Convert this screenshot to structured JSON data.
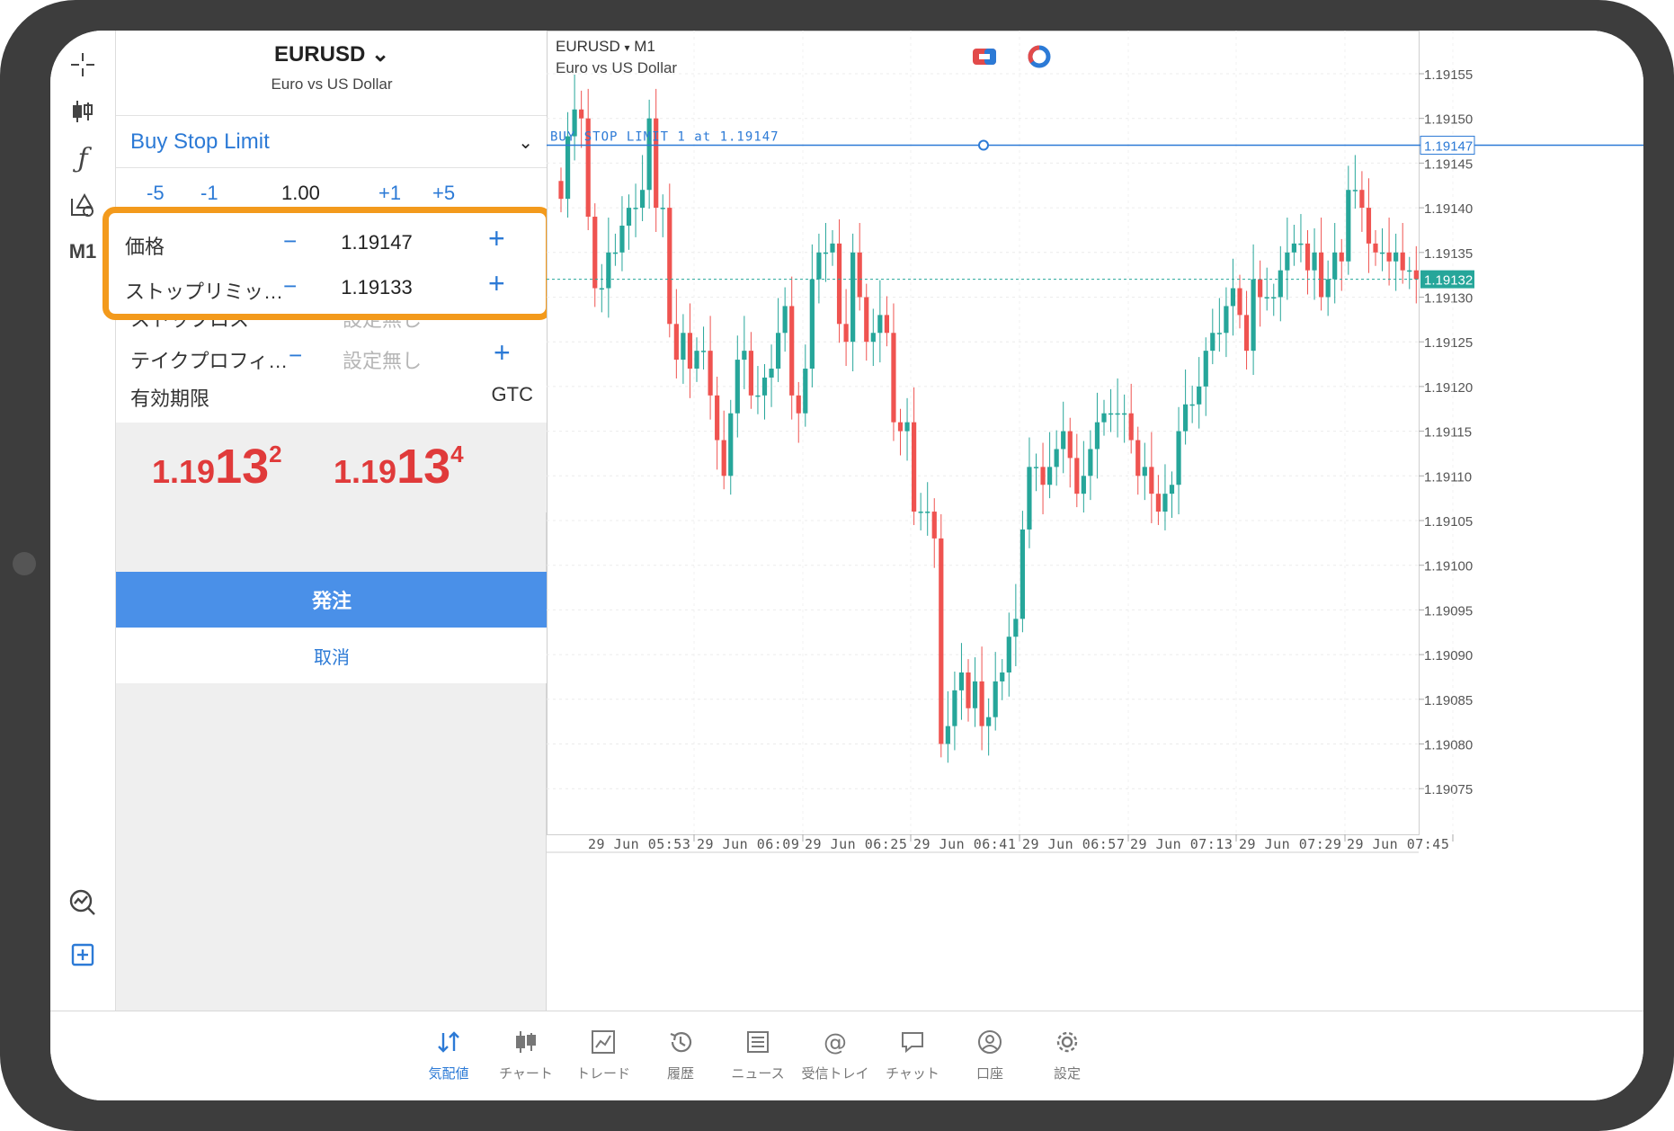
{
  "symbol": {
    "name": "EURUSD",
    "description": "Euro vs US Dollar"
  },
  "order": {
    "type": "Buy Stop Limit",
    "volume_steps": [
      "-5",
      "-1",
      "1.00",
      "+1",
      "+5"
    ],
    "fields": [
      {
        "label": "価格",
        "value": "1.19147",
        "muted": false
      },
      {
        "label": "ストップリミッ…",
        "value": "1.19133",
        "muted": false
      },
      {
        "label": "ストップロス",
        "value": "設定無し",
        "muted": true
      },
      {
        "label": "テイクプロフィ…",
        "value": "設定無し",
        "muted": true
      }
    ],
    "expiry_label": "有効期限",
    "expiry_value": "GTC",
    "bid": {
      "prefix": "1.19",
      "big": "13",
      "sup": "2"
    },
    "ask": {
      "prefix": "1.19",
      "big": "13",
      "sup": "4"
    },
    "submit_label": "発注",
    "cancel_label": "取消"
  },
  "rail": {
    "timeframe": "M1",
    "icons": [
      "crosshair-icon",
      "chart-type-icon",
      "indicator-icon",
      "objects-icon",
      "analytics-icon",
      "new-order-icon"
    ]
  },
  "chart_header": {
    "symbol": "EURUSD",
    "arrow": "▾",
    "timeframe": "M1",
    "description": "Euro vs US Dollar"
  },
  "chart_data": {
    "type": "candlestick",
    "y_ticks": [
      "1.19155",
      "1.19150",
      "1.19145",
      "1.19140",
      "1.19135",
      "1.19130",
      "1.19125",
      "1.19120",
      "1.19115",
      "1.19110",
      "1.19105",
      "1.19100",
      "1.19095",
      "1.19090",
      "1.19085",
      "1.19080",
      "1.19075"
    ],
    "y_tick_values": [
      1.19155,
      1.1915,
      1.19145,
      1.1914,
      1.19135,
      1.1913,
      1.19125,
      1.1912,
      1.19115,
      1.1911,
      1.19105,
      1.191,
      1.19095,
      1.1909,
      1.19085,
      1.1908,
      1.19075
    ],
    "x_ticks": [
      "29 Jun 05:53",
      "29 Jun 06:09",
      "29 Jun 06:25",
      "29 Jun 06:41",
      "29 Jun 06:57",
      "29 Jun 07:13",
      "29 Jun 07:29",
      "29 Jun 07:45"
    ],
    "order_line": {
      "label": "BUY STOP LIMIT 1 at 1.19147",
      "price": 1.19147,
      "price_label": "1.19147",
      "color": "#2c7ad6"
    },
    "bid_line": {
      "price": 1.19132,
      "price_label": "1.19132",
      "color": "#26a69a"
    },
    "colors": {
      "up": "#26a69a",
      "down": "#ef5350"
    },
    "close_series": [
      1.19141,
      1.19148,
      1.19151,
      1.1915,
      1.19139,
      1.19131,
      1.19131,
      1.19135,
      1.19135,
      1.19138,
      1.1914,
      1.1914,
      1.19142,
      1.1915,
      1.1914,
      1.1914,
      1.19127,
      1.19123,
      1.19126,
      1.19122,
      1.19124,
      1.19124,
      1.19119,
      1.19114,
      1.1911,
      1.19117,
      1.19123,
      1.19124,
      1.19119,
      1.19119,
      1.19121,
      1.19122,
      1.19126,
      1.19129,
      1.19119,
      1.19117,
      1.19122,
      1.19132,
      1.19135,
      1.19135,
      1.19136,
      1.19127,
      1.19125,
      1.19135,
      1.1913,
      1.19125,
      1.19126,
      1.19128,
      1.19126,
      1.19116,
      1.19115,
      1.19116,
      1.19106,
      1.19106,
      1.19106,
      1.19103,
      1.1908,
      1.19082,
      1.19086,
      1.19088,
      1.19084,
      1.19087,
      1.19082,
      1.19083,
      1.19087,
      1.19088,
      1.19092,
      1.19094,
      1.19104,
      1.19111,
      1.19111,
      1.19109,
      1.19111,
      1.19113,
      1.19115,
      1.19112,
      1.19108,
      1.1911,
      1.19113,
      1.19116,
      1.19117,
      1.19117,
      1.19117,
      1.19117,
      1.19114,
      1.1911,
      1.19111,
      1.19108,
      1.19106,
      1.19108,
      1.19109,
      1.19115,
      1.19118,
      1.19118,
      1.1912,
      1.19124,
      1.19126,
      1.19126,
      1.19129,
      1.19131,
      1.19128,
      1.19124,
      1.19132,
      1.1913,
      1.1913,
      1.1913,
      1.19133,
      1.19135,
      1.19136,
      1.19136,
      1.19133,
      1.19135,
      1.1913,
      1.19132,
      1.19135,
      1.19134,
      1.19142,
      1.19142,
      1.1914,
      1.19136,
      1.19135,
      1.19135,
      1.19134,
      1.19135,
      1.19133,
      1.19133,
      1.19132
    ]
  },
  "tabs": [
    {
      "label": "気配値",
      "icon": "quotes-icon",
      "active": true
    },
    {
      "label": "チャート",
      "icon": "chart-icon",
      "active": false
    },
    {
      "label": "トレード",
      "icon": "trade-icon",
      "active": false
    },
    {
      "label": "履歴",
      "icon": "history-icon",
      "active": false
    },
    {
      "label": "ニュース",
      "icon": "news-icon",
      "active": false
    },
    {
      "label": "受信トレイ",
      "icon": "mail-icon",
      "active": false
    },
    {
      "label": "チャット",
      "icon": "chat-icon",
      "active": false
    },
    {
      "label": "口座",
      "icon": "account-icon",
      "active": false
    },
    {
      "label": "設定",
      "icon": "settings-icon",
      "active": false
    }
  ]
}
